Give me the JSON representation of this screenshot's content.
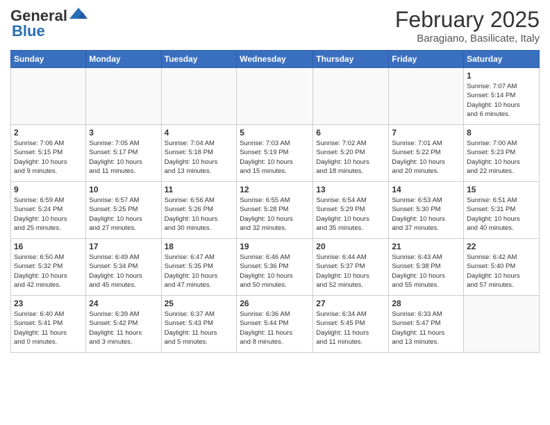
{
  "header": {
    "logo_general": "General",
    "logo_blue": "Blue",
    "month_title": "February 2025",
    "location": "Baragiano, Basilicate, Italy"
  },
  "days_of_week": [
    "Sunday",
    "Monday",
    "Tuesday",
    "Wednesday",
    "Thursday",
    "Friday",
    "Saturday"
  ],
  "weeks": [
    [
      {
        "day": "",
        "info": ""
      },
      {
        "day": "",
        "info": ""
      },
      {
        "day": "",
        "info": ""
      },
      {
        "day": "",
        "info": ""
      },
      {
        "day": "",
        "info": ""
      },
      {
        "day": "",
        "info": ""
      },
      {
        "day": "1",
        "info": "Sunrise: 7:07 AM\nSunset: 5:14 PM\nDaylight: 10 hours\nand 6 minutes."
      }
    ],
    [
      {
        "day": "2",
        "info": "Sunrise: 7:06 AM\nSunset: 5:15 PM\nDaylight: 10 hours\nand 9 minutes."
      },
      {
        "day": "3",
        "info": "Sunrise: 7:05 AM\nSunset: 5:17 PM\nDaylight: 10 hours\nand 11 minutes."
      },
      {
        "day": "4",
        "info": "Sunrise: 7:04 AM\nSunset: 5:18 PM\nDaylight: 10 hours\nand 13 minutes."
      },
      {
        "day": "5",
        "info": "Sunrise: 7:03 AM\nSunset: 5:19 PM\nDaylight: 10 hours\nand 15 minutes."
      },
      {
        "day": "6",
        "info": "Sunrise: 7:02 AM\nSunset: 5:20 PM\nDaylight: 10 hours\nand 18 minutes."
      },
      {
        "day": "7",
        "info": "Sunrise: 7:01 AM\nSunset: 5:22 PM\nDaylight: 10 hours\nand 20 minutes."
      },
      {
        "day": "8",
        "info": "Sunrise: 7:00 AM\nSunset: 5:23 PM\nDaylight: 10 hours\nand 22 minutes."
      }
    ],
    [
      {
        "day": "9",
        "info": "Sunrise: 6:59 AM\nSunset: 5:24 PM\nDaylight: 10 hours\nand 25 minutes."
      },
      {
        "day": "10",
        "info": "Sunrise: 6:57 AM\nSunset: 5:25 PM\nDaylight: 10 hours\nand 27 minutes."
      },
      {
        "day": "11",
        "info": "Sunrise: 6:56 AM\nSunset: 5:26 PM\nDaylight: 10 hours\nand 30 minutes."
      },
      {
        "day": "12",
        "info": "Sunrise: 6:55 AM\nSunset: 5:28 PM\nDaylight: 10 hours\nand 32 minutes."
      },
      {
        "day": "13",
        "info": "Sunrise: 6:54 AM\nSunset: 5:29 PM\nDaylight: 10 hours\nand 35 minutes."
      },
      {
        "day": "14",
        "info": "Sunrise: 6:53 AM\nSunset: 5:30 PM\nDaylight: 10 hours\nand 37 minutes."
      },
      {
        "day": "15",
        "info": "Sunrise: 6:51 AM\nSunset: 5:31 PM\nDaylight: 10 hours\nand 40 minutes."
      }
    ],
    [
      {
        "day": "16",
        "info": "Sunrise: 6:50 AM\nSunset: 5:32 PM\nDaylight: 10 hours\nand 42 minutes."
      },
      {
        "day": "17",
        "info": "Sunrise: 6:49 AM\nSunset: 5:34 PM\nDaylight: 10 hours\nand 45 minutes."
      },
      {
        "day": "18",
        "info": "Sunrise: 6:47 AM\nSunset: 5:35 PM\nDaylight: 10 hours\nand 47 minutes."
      },
      {
        "day": "19",
        "info": "Sunrise: 6:46 AM\nSunset: 5:36 PM\nDaylight: 10 hours\nand 50 minutes."
      },
      {
        "day": "20",
        "info": "Sunrise: 6:44 AM\nSunset: 5:37 PM\nDaylight: 10 hours\nand 52 minutes."
      },
      {
        "day": "21",
        "info": "Sunrise: 6:43 AM\nSunset: 5:38 PM\nDaylight: 10 hours\nand 55 minutes."
      },
      {
        "day": "22",
        "info": "Sunrise: 6:42 AM\nSunset: 5:40 PM\nDaylight: 10 hours\nand 57 minutes."
      }
    ],
    [
      {
        "day": "23",
        "info": "Sunrise: 6:40 AM\nSunset: 5:41 PM\nDaylight: 11 hours\nand 0 minutes."
      },
      {
        "day": "24",
        "info": "Sunrise: 6:39 AM\nSunset: 5:42 PM\nDaylight: 11 hours\nand 3 minutes."
      },
      {
        "day": "25",
        "info": "Sunrise: 6:37 AM\nSunset: 5:43 PM\nDaylight: 11 hours\nand 5 minutes."
      },
      {
        "day": "26",
        "info": "Sunrise: 6:36 AM\nSunset: 5:44 PM\nDaylight: 11 hours\nand 8 minutes."
      },
      {
        "day": "27",
        "info": "Sunrise: 6:34 AM\nSunset: 5:45 PM\nDaylight: 11 hours\nand 11 minutes."
      },
      {
        "day": "28",
        "info": "Sunrise: 6:33 AM\nSunset: 5:47 PM\nDaylight: 11 hours\nand 13 minutes."
      },
      {
        "day": "",
        "info": ""
      }
    ]
  ]
}
